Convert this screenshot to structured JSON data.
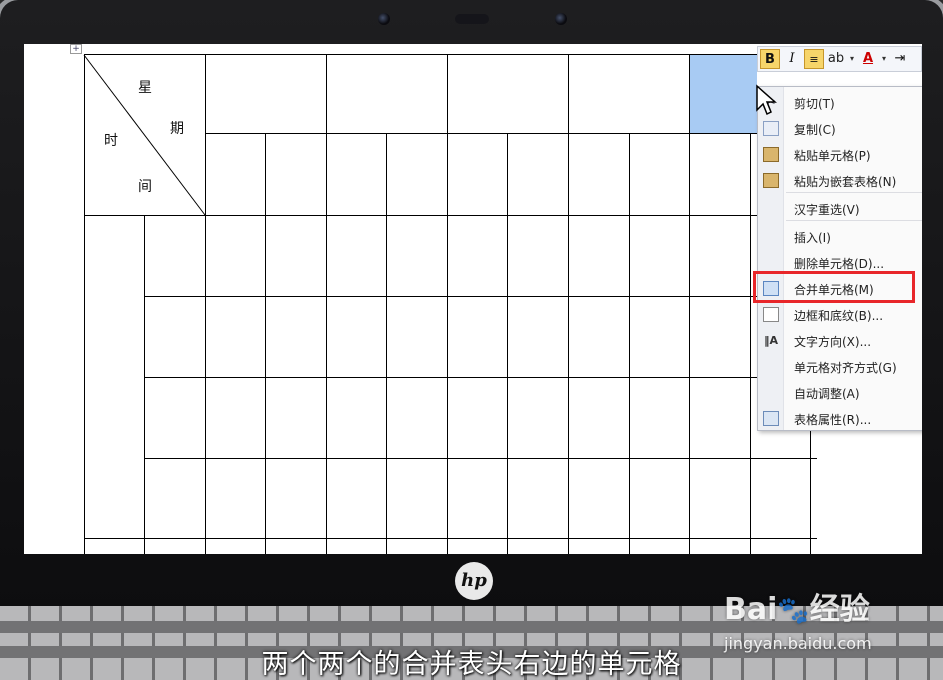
{
  "table": {
    "header_cell": {
      "label_xingqi_1": "星",
      "label_xingqi_2": "期",
      "label_shijian_1": "时",
      "label_shijian_2": "间"
    },
    "move_handle_glyph": "+",
    "selected_cell_color": "#a8cbf3"
  },
  "mini_toolbar": {
    "bold": "B",
    "italic": "I",
    "center": "≡",
    "highlight": "ab",
    "font_color": "A",
    "indent": "⇥"
  },
  "context_menu": {
    "items": [
      {
        "label": "剪切(T)",
        "icon": "scissors-icon"
      },
      {
        "label": "复制(C)",
        "icon": "copy-icon"
      },
      {
        "label": "粘贴单元格(P)",
        "icon": "paste-icon"
      },
      {
        "label": "粘贴为嵌套表格(N)",
        "icon": "paste-icon"
      },
      {
        "label": "汉字重选(V)",
        "icon": ""
      },
      {
        "label": "插入(I)",
        "icon": ""
      },
      {
        "label": "删除单元格(D)...",
        "icon": ""
      },
      {
        "label": "合并单元格(M)",
        "icon": "merge-cells-icon"
      },
      {
        "label": "边框和底纹(B)...",
        "icon": "borders-icon"
      },
      {
        "label": "文字方向(X)...",
        "icon": "text-direction-icon"
      },
      {
        "label": "单元格对齐方式(G)",
        "icon": ""
      },
      {
        "label": "自动调整(A)",
        "icon": ""
      },
      {
        "label": "表格属性(R)...",
        "icon": "table-properties-icon"
      }
    ],
    "highlight_color": "#e8262a"
  },
  "laptop": {
    "brand": "hp"
  },
  "subtitle": "两个两个的合并表头右边的单元格",
  "watermark": {
    "brand_prefix": "Bai",
    "brand_suffix": "经验",
    "url": "jingyan.baidu.com"
  }
}
